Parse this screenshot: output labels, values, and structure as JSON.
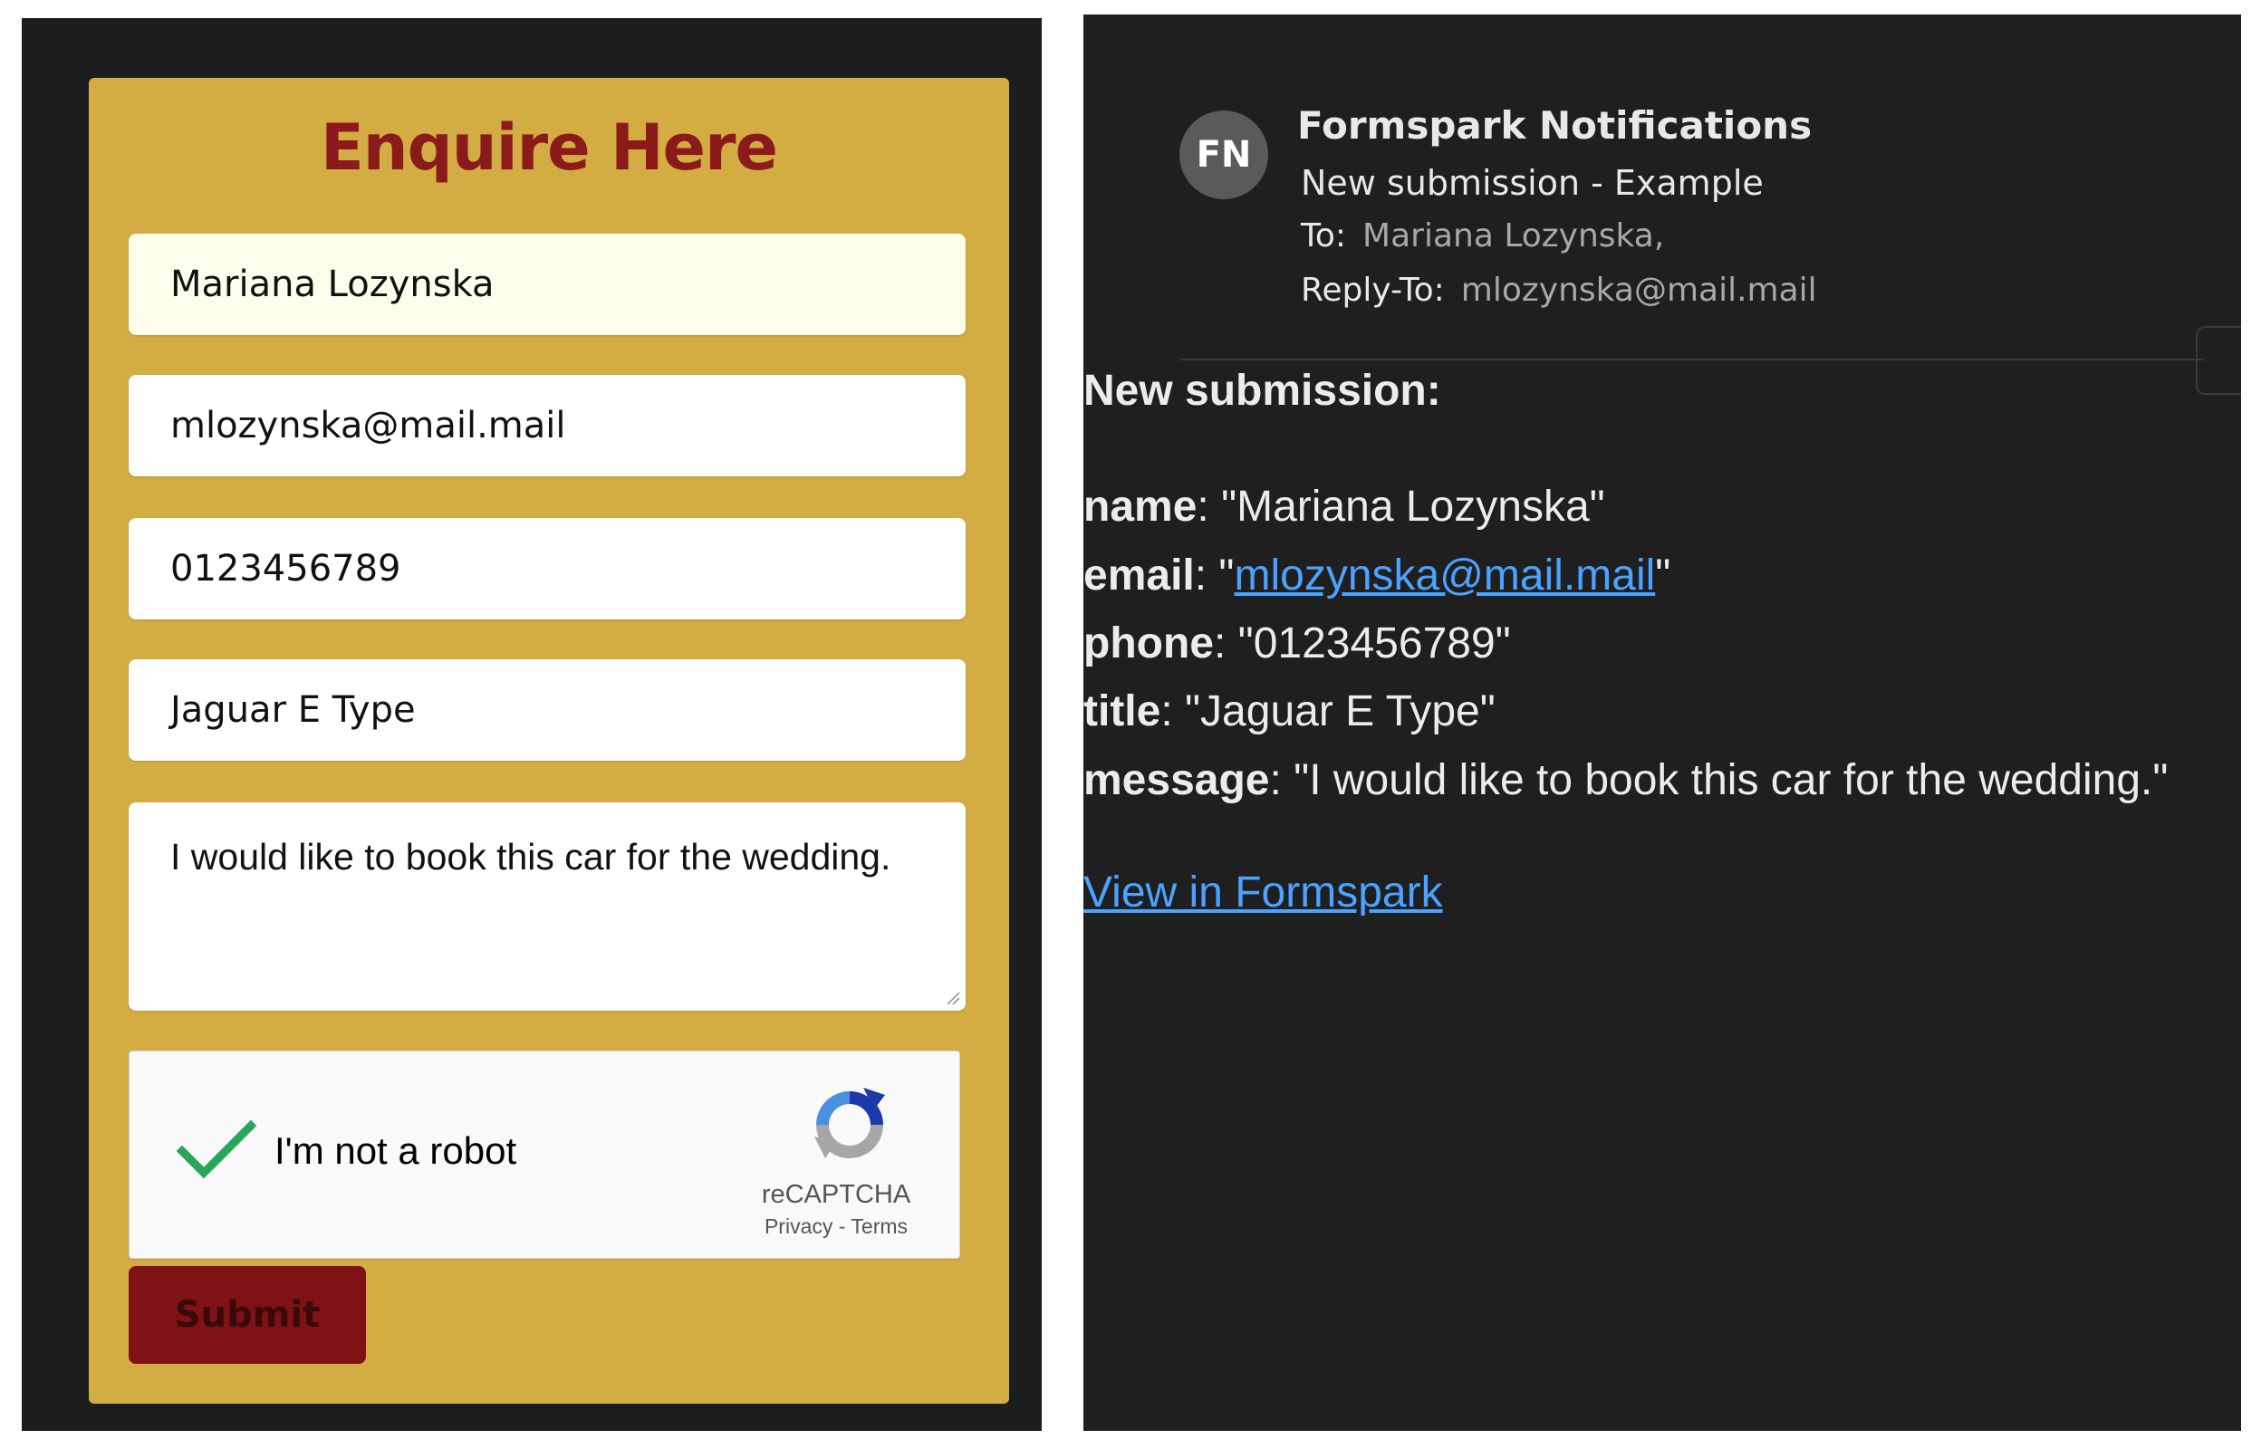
{
  "form": {
    "title": "Enquire Here",
    "name_value": "Mariana Lozynska",
    "email_value": "mlozynska@mail.mail",
    "phone_value": "0123456789",
    "title_value": "Jaguar E Type",
    "message_value": "I would like to book this car for the wedding.",
    "captcha": {
      "checked": true,
      "label": "I'm not a robot",
      "brand": "reCAPTCHA",
      "privacy": "Privacy",
      "separator": " - ",
      "terms": "Terms"
    },
    "submit_label": "Submit"
  },
  "email": {
    "avatar_initials": "FN",
    "sender": "Formspark Notifications",
    "subject": "New submission - Example",
    "to_label": "To:",
    "to_value": "Mariana Lozynska,",
    "reply_to_label": "Reply-To:",
    "reply_to_value": "mlozynska@mail.mail",
    "body_heading": "New submission:",
    "fields": {
      "name_key": "name",
      "name_value": "\"Mariana Lozynska\"",
      "email_key": "email",
      "email_value": "mlozynska@mail.mail",
      "phone_key": "phone",
      "phone_value": "\"0123456789\"",
      "title_key": "title",
      "title_value": "\"Jaguar E Type\"",
      "message_key": "message",
      "message_value": "\"I would like to book this car for the wedding.\""
    },
    "view_link": "View in Formspark"
  },
  "colors": {
    "form_background": "#d4ac44",
    "title_color": "#8b1a1a",
    "submit_background": "#7f1215",
    "link_color": "#4aa3ff",
    "email_background": "#1f1f1f"
  }
}
